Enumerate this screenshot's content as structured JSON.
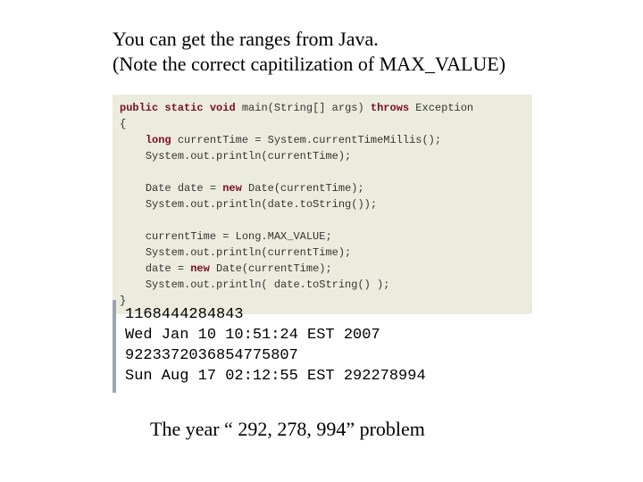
{
  "heading": {
    "line1": "You can get the ranges from Java.",
    "line2": "(Note the correct capitilization of MAX_VALUE)"
  },
  "code": {
    "kw_public": "public",
    "kw_static": "static",
    "kw_void": "void",
    "sig_mid": " main(String[] args) ",
    "kw_throws": "throws",
    "sig_tail": " Exception",
    "lbrace": "{",
    "indent": "    ",
    "kw_long": "long",
    "l1": " currentTime = System.currentTimeMillis();",
    "l2": "System.out.println(currentTime);",
    "blank": "",
    "l3a": "Date date = ",
    "kw_new1": "new",
    "l3b": " Date(currentTime);",
    "l4": "System.out.println(date.toString());",
    "l5": "currentTime = Long.MAX_VALUE;",
    "l6": "System.out.println(currentTime);",
    "l7a": "date = ",
    "kw_new2": "new",
    "l7b": " Date(currentTime);",
    "l8": "System.out.println( date.toString() );",
    "rbrace": "}"
  },
  "output": {
    "l1": "1168444284843",
    "l2": "Wed Jan 10 10:51:24 EST 2007",
    "l3": "9223372036854775807",
    "l4": "Sun Aug 17 02:12:55 EST 292278994"
  },
  "footer": "The year “ 292, 278, 994” problem"
}
